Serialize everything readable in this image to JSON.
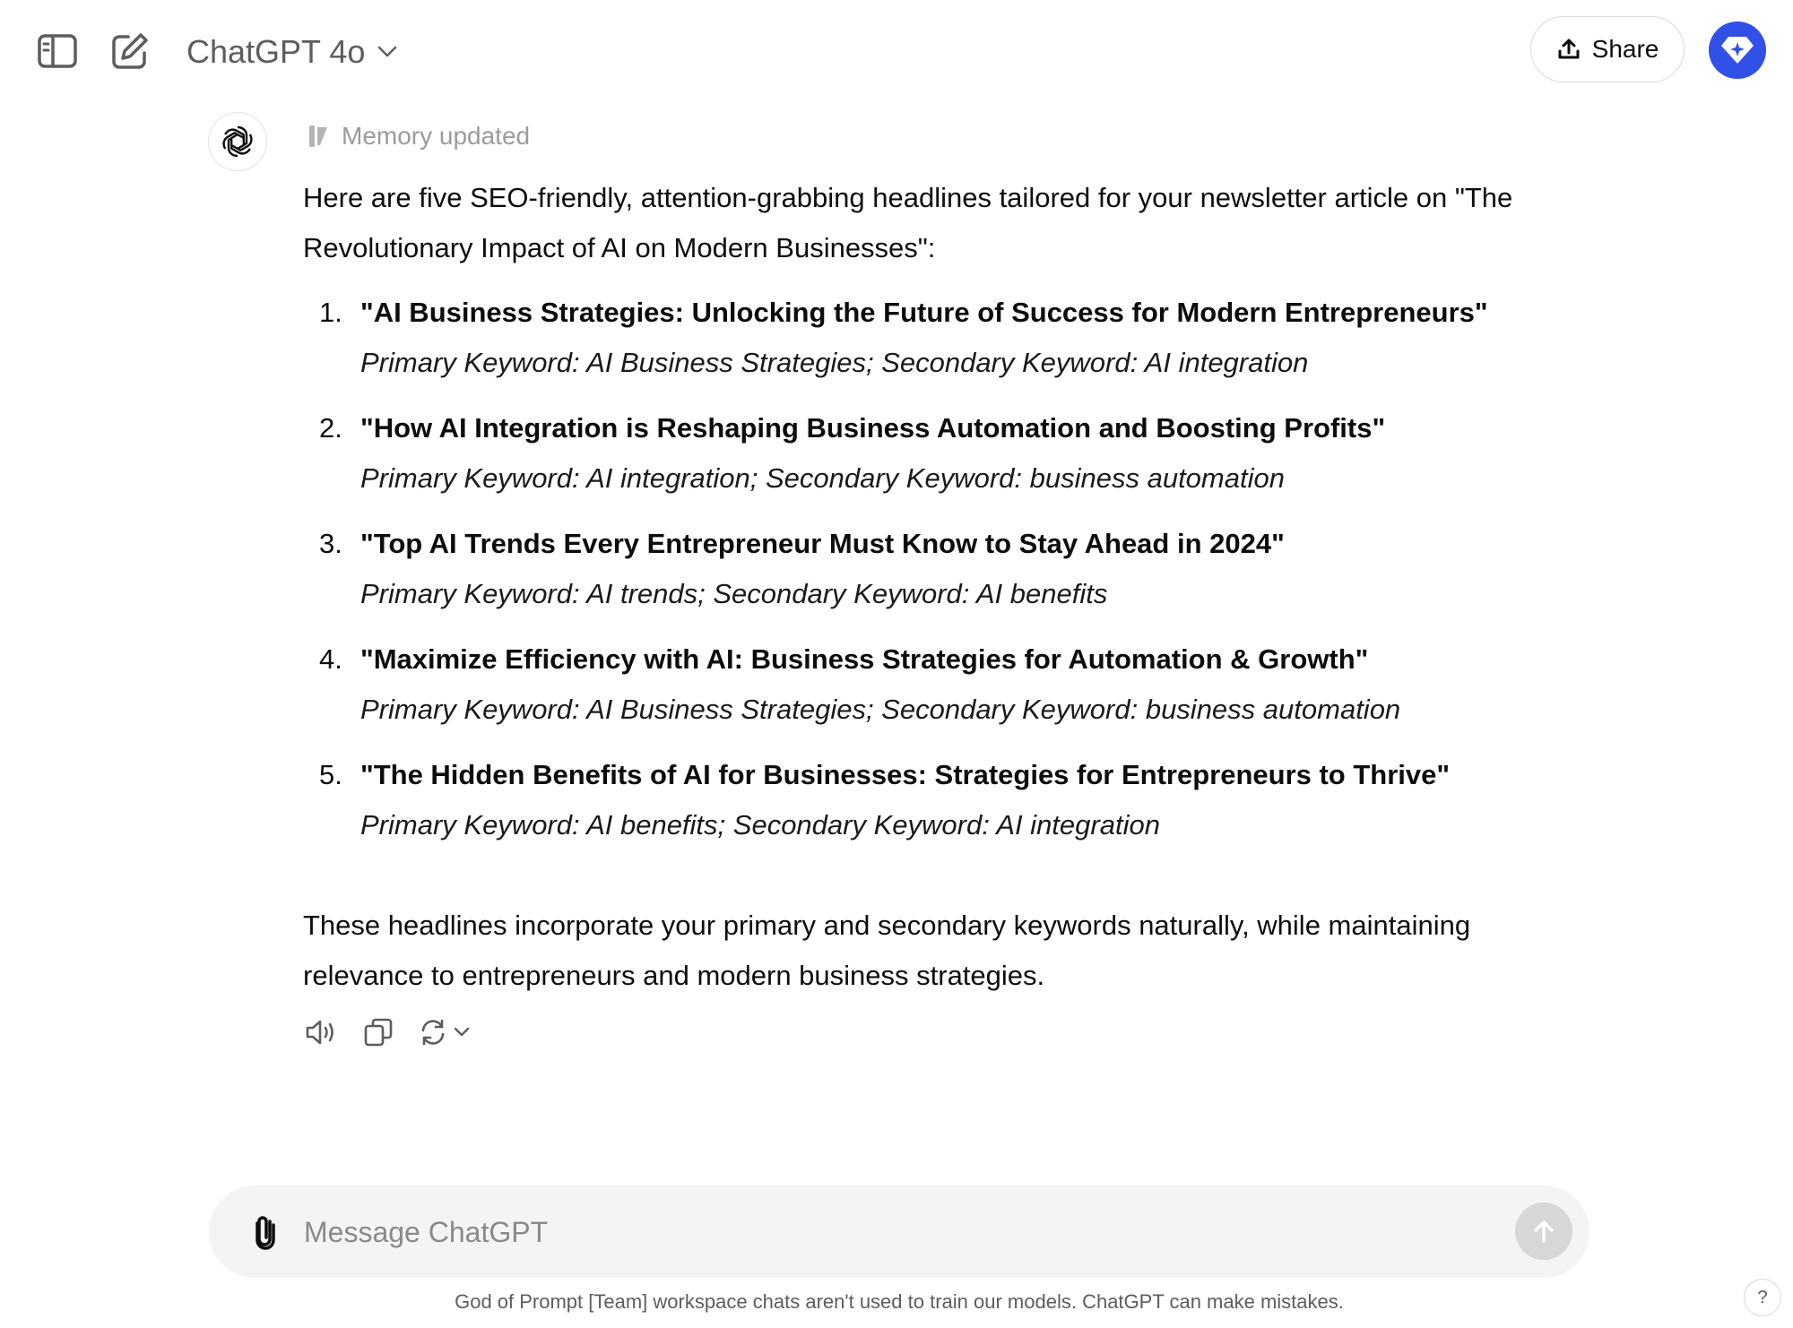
{
  "header": {
    "model_name": "ChatGPT 4o",
    "share_label": "Share",
    "icons": {
      "sidebar_toggle": "sidebar-toggle-icon",
      "new_chat": "new-chat-icon",
      "model_dropdown": "chevron-down-icon",
      "share": "share-upload-icon",
      "account": "diamond-sparkle-icon"
    }
  },
  "message": {
    "memory_status": "Memory updated",
    "intro": "Here are five SEO-friendly, attention-grabbing headlines tailored for your newsletter article on \"The Revolutionary Impact of AI on Modern Businesses\":",
    "headlines": [
      {
        "number": "1.",
        "title": "\"AI Business Strategies: Unlocking the Future of Success for Modern Entrepreneurs\"",
        "keywords": "Primary Keyword: AI Business Strategies; Secondary Keyword: AI integration"
      },
      {
        "number": "2.",
        "title": "\"How AI Integration is Reshaping Business Automation and Boosting Profits\"",
        "keywords": "Primary Keyword: AI integration; Secondary Keyword: business automation"
      },
      {
        "number": "3.",
        "title": "\"Top AI Trends Every Entrepreneur Must Know to Stay Ahead in 2024\"",
        "keywords": "Primary Keyword: AI trends; Secondary Keyword: AI benefits"
      },
      {
        "number": "4.",
        "title": "\"Maximize Efficiency with AI: Business Strategies for Automation & Growth\"",
        "keywords": "Primary Keyword: AI Business Strategies; Secondary Keyword: business automation"
      },
      {
        "number": "5.",
        "title": "\"The Hidden Benefits of AI for Businesses: Strategies for Entrepreneurs to Thrive\"",
        "keywords": "Primary Keyword: AI benefits; Secondary Keyword: AI integration"
      }
    ],
    "closing": "These headlines incorporate your primary and secondary keywords naturally, while maintaining relevance to entrepreneurs and modern business strategies.",
    "action_icons": [
      "read-aloud-icon",
      "copy-icon",
      "regenerate-icon",
      "chevron-down-icon"
    ]
  },
  "composer": {
    "placeholder": "Message ChatGPT",
    "value": "",
    "icons": {
      "attach": "paperclip-icon",
      "send": "arrow-up-icon"
    }
  },
  "footer": {
    "disclaimer": "God of Prompt [Team] workspace chats aren't used to train our models. ChatGPT can make mistakes.",
    "help_label": "?"
  },
  "colors": {
    "account_accent": "#3150e8",
    "muted_text": "#9b9b9b",
    "composer_bg": "#f4f4f4"
  }
}
